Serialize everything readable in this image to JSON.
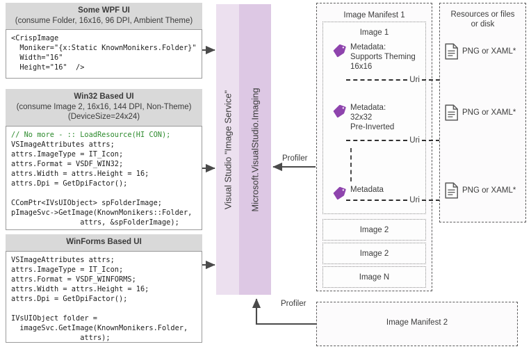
{
  "panels": {
    "wpf": {
      "title": "Some WPF UI",
      "subtitle": "(consume Folder, 16x16, 96 DPI, Ambient Theme)",
      "code": "<CrispImage\n  Moniker=\"{x:Static KnownMonikers.Folder}\"\n  Width=\"16\"\n  Height=\"16\"  />"
    },
    "win32": {
      "title": "Win32 Based UI",
      "subtitle": "(consume Image 2, 16x16, 144 DPI, Non-Theme)",
      "subtitle2": "(DeviceSize=24x24)",
      "comment": "// No more - :: LoadResource(HI CON);",
      "code": "VSImageAttributes attrs;\nattrs.ImageType = IT_Icon;\nattrs.Format = VSDF_WIN32;\nattrs.Width = attrs.Height = 16;\nattrs.Dpi = GetDpiFactor();\n\nCComPtr<IVsUIObject> spFolderImage;\npImageSvc->GetImage(KnownMonikers::Folder,\n                attrs, &spFolderImage);"
    },
    "winforms": {
      "title": "WinForms Based UI",
      "code": "VSImageAttributes attrs;\nattrs.ImageType = IT_Icon;\nattrs.Format = VSDF_WINFORMS;\nattrs.Width = attrs.Height = 16;\nattrs.Dpi = GetDpiFactor();\n\nIVsUIObject folder =\n  imageSvc.GetImage(KnownMonikers.Folder,\n                attrs);"
    }
  },
  "service_bars": {
    "image_service": "Visual Studio \"Image Service\"",
    "assembly": "Microsoft.VisualStudio.Imaging"
  },
  "manifest1": {
    "title": "Image Manifest 1",
    "image1_label": "Image 1",
    "metadata": [
      {
        "text": "Metadata:\nSupports Theming\n16x16",
        "uri_label": "Uri"
      },
      {
        "text": "Metadata:\n32x32\nPre-Inverted",
        "uri_label": "Uri"
      },
      {
        "text": "Metadata",
        "uri_label": "Uri"
      }
    ],
    "other_images": [
      "Image 2",
      "Image 2",
      "Image N"
    ]
  },
  "manifest2": {
    "title": "Image Manifest 2"
  },
  "resources": {
    "title": "Resources or files\nor disk",
    "items": [
      "PNG or XAML*",
      "PNG or XAML*",
      "PNG or XAML*"
    ]
  },
  "profiler_labels": {
    "top": "Profiler",
    "bottom": "Profiler"
  },
  "colors": {
    "header_gray": "#d9d9d9",
    "service_bar_light": "#ece0ef",
    "service_bar_dark": "#ddc8e4",
    "tag_purple": "#8e44ad",
    "comment_green": "#2e8b2e",
    "arrow_gray": "#4a4a4a"
  }
}
